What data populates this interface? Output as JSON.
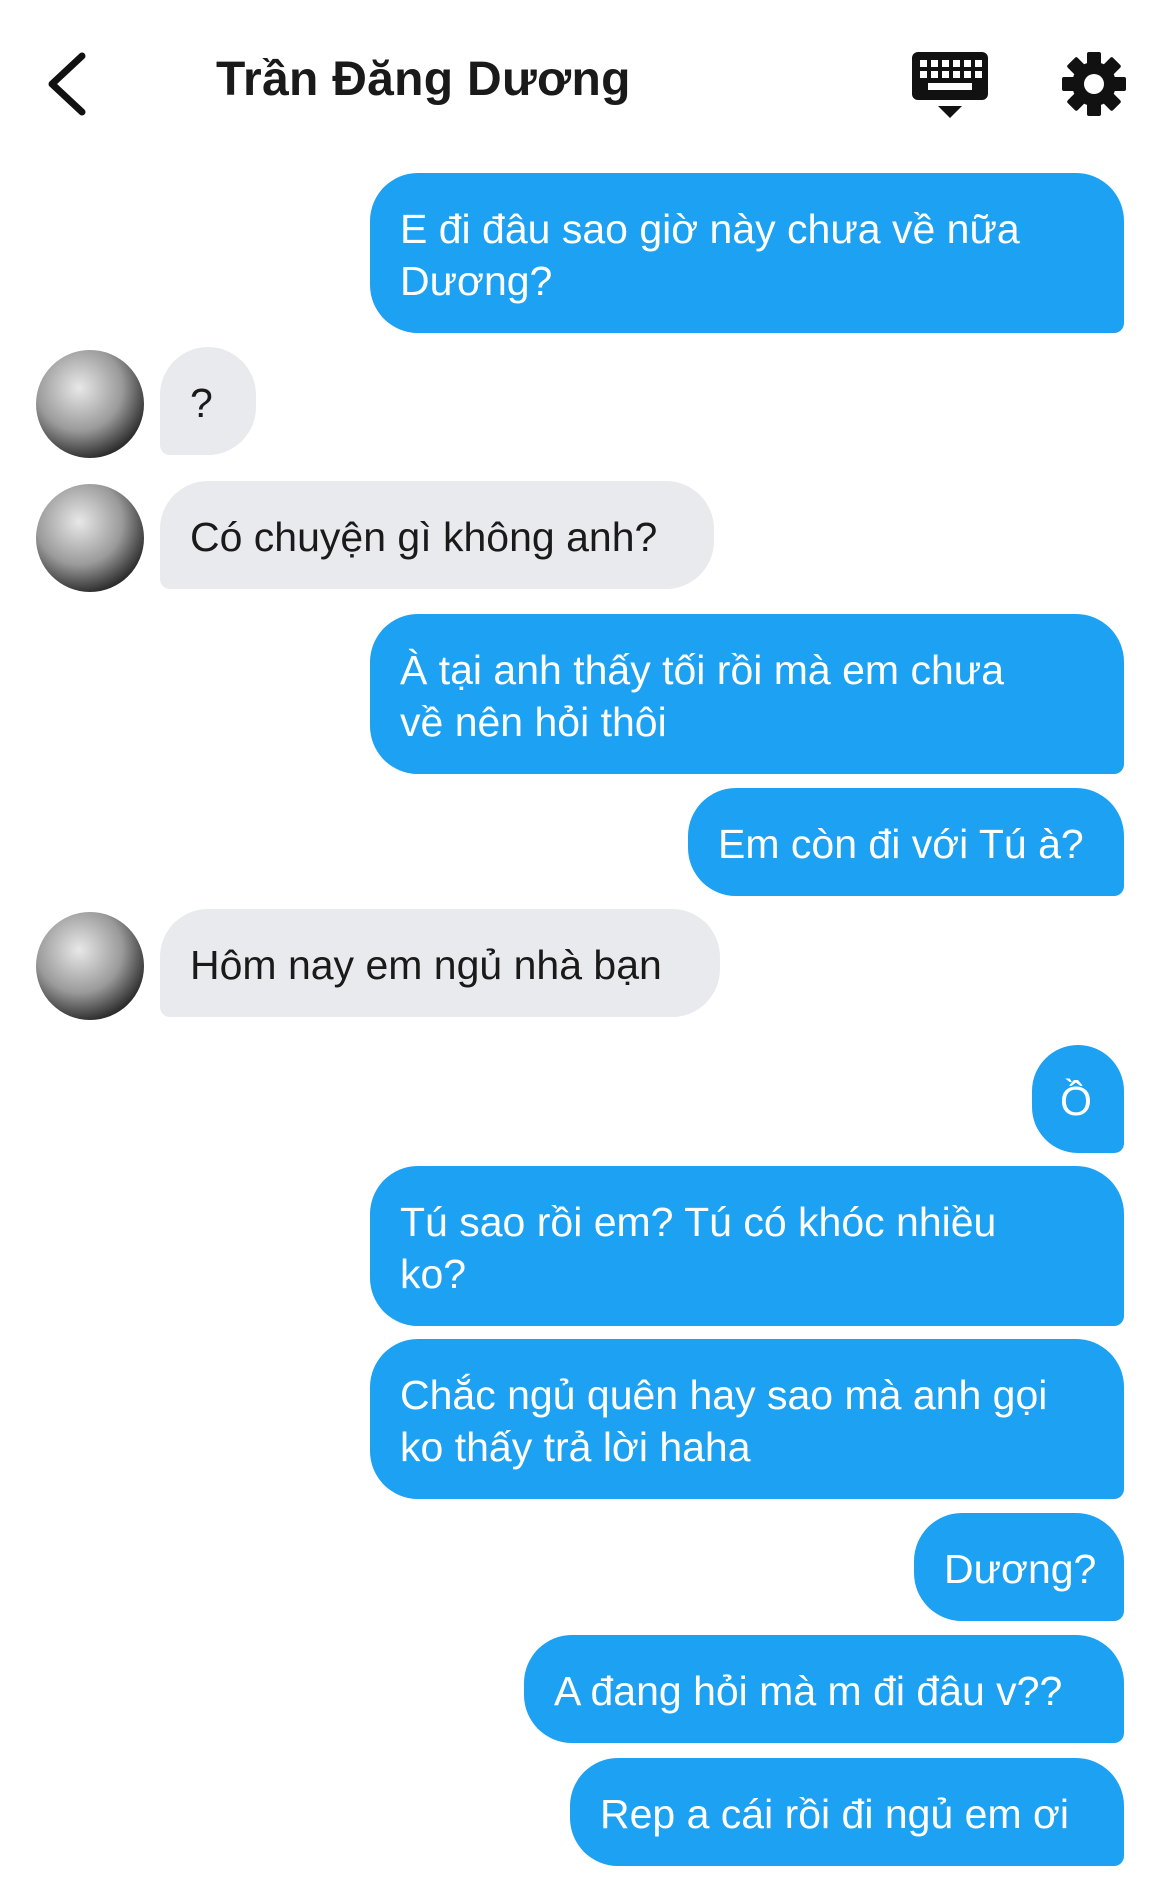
{
  "header": {
    "title": "Trần Đăng Dương",
    "back_icon": "chevron-left-icon",
    "keyboard_icon": "keyboard-icon",
    "settings_icon": "gear-icon"
  },
  "colors": {
    "outgoing_bubble": "#1da1f2",
    "incoming_bubble": "#e8eaed",
    "outgoing_text": "#ffffff",
    "incoming_text": "#1a1a1a"
  },
  "messages": [
    {
      "direction": "outgoing",
      "text": "E đi đâu sao giờ này chưa về nữa\nDương?"
    },
    {
      "direction": "incoming",
      "text": "?"
    },
    {
      "direction": "incoming",
      "text": "Có chuyện gì không anh?"
    },
    {
      "direction": "outgoing",
      "text": "À tại anh thấy tối rồi mà em chưa\nvề nên hỏi thôi"
    },
    {
      "direction": "outgoing",
      "text": "Em còn đi với Tú à?"
    },
    {
      "direction": "incoming",
      "text": "Hôm nay em ngủ nhà bạn"
    },
    {
      "direction": "outgoing",
      "text": "Ồ"
    },
    {
      "direction": "outgoing",
      "text": "Tú sao rồi em? Tú có khóc nhiều\nko?"
    },
    {
      "direction": "outgoing",
      "text": "Chắc ngủ quên hay sao mà anh gọi\nko thấy trả lời haha"
    },
    {
      "direction": "outgoing",
      "text": "Dương?"
    },
    {
      "direction": "outgoing",
      "text": "A đang hỏi mà m đi đâu v??"
    },
    {
      "direction": "outgoing",
      "text": "Rep a cái rồi đi ngủ em ơi"
    }
  ]
}
